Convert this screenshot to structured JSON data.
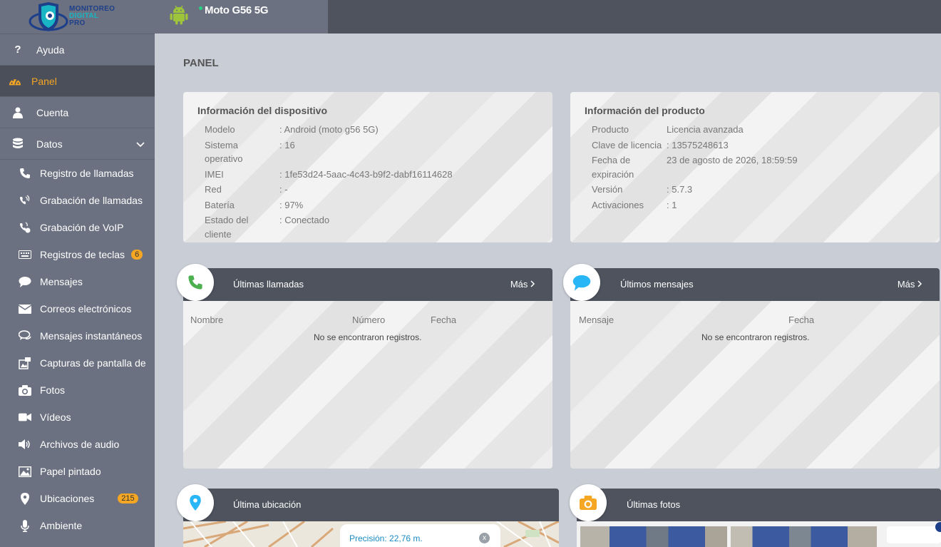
{
  "brand": {
    "line1": "MONITOREO",
    "line2": "DIGITAL",
    "line3": "PRO"
  },
  "device": {
    "name": "Moto G56 5G",
    "status_color": "#27d17f"
  },
  "page_title": "PANEL",
  "colors": {
    "accent": "#f5a623",
    "sidebar": "#6b7180",
    "header": "#4e535e"
  },
  "nav": {
    "ayuda": "Ayuda",
    "panel": "Panel",
    "cuenta": "Cuenta",
    "datos": "Datos",
    "sub": {
      "llamadas": "Registro de llamadas",
      "grabacion": "Grabación de llamadas",
      "voip": "Grabación de VoIP",
      "teclas": "Registros de teclas",
      "teclas_badge": "6",
      "mensajes": "Mensajes",
      "correos": "Correos electrónicos",
      "instantaneos": "Mensajes instantáneos",
      "capturas": "Capturas de pantalla de",
      "fotos": "Fotos",
      "videos": "Vídeos",
      "audio": "Archivos de audio",
      "papel": "Papel pintado",
      "ubicaciones": "Ubicaciones",
      "ubicaciones_badge": "215",
      "ambiente": "Ambiente"
    }
  },
  "device_info": {
    "title": "Información del dispositivo",
    "rows": [
      {
        "k": "Modelo",
        "v": ": Android (moto g56 5G)"
      },
      {
        "k": "Sistema",
        "k2": "operativo",
        "v": ": 16"
      },
      {
        "k": "IMEI",
        "v": ": 1fe53d24-5aac-4c43-b9f2-dabf16114628"
      },
      {
        "k": "Red",
        "v": ": -"
      },
      {
        "k": "Batería",
        "v": ": 97%"
      },
      {
        "k": "Estado del",
        "k2": "cliente",
        "v": ": Conectado"
      }
    ]
  },
  "product_info": {
    "title": "Información del producto",
    "rows": [
      {
        "k": "Producto",
        "v": "Licencia avanzada"
      },
      {
        "k": "Clave de licencia",
        "v": ": 13575248613"
      },
      {
        "k": "Fecha de",
        "k2": "expiración",
        "v": "23 de agosto de 2026, 18:59:59"
      },
      {
        "k": "Versión",
        "v": ": 5.7.3"
      },
      {
        "k": "Activaciones",
        "v": ": 1"
      }
    ]
  },
  "calls": {
    "title": "Últimas llamadas",
    "more": "Más",
    "col_name": "Nombre",
    "col_number": "Número",
    "col_date": "Fecha",
    "empty": "No se encontraron registros."
  },
  "messages": {
    "title": "Últimos mensajes",
    "more": "Más",
    "col_message": "Mensaje",
    "col_date": "Fecha",
    "empty": "No se encontraron registros."
  },
  "location": {
    "title": "Última ubicación",
    "precision": "Precisión: 22,76 m."
  },
  "photos": {
    "title": "Últimas fotos"
  }
}
